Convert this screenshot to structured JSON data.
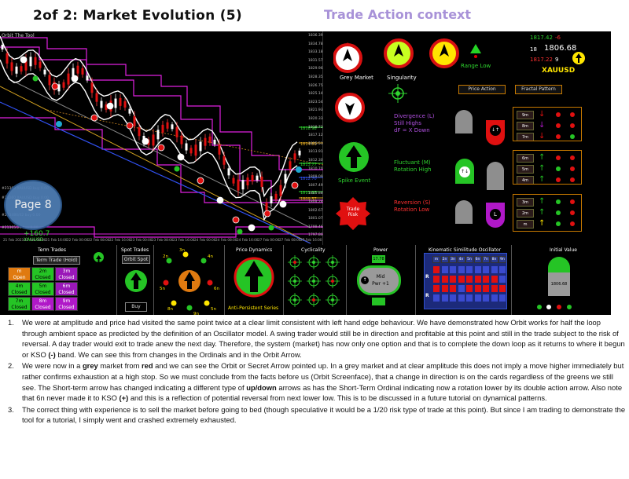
{
  "header": {
    "title": "2of 2: Market Evolution (5)",
    "context": "Trade Action context"
  },
  "chart": {
    "info": "Orbit The Tool",
    "price_labels": [
      "1818.98",
      "1814.81",
      "1813.77",
      "1812.70",
      "1811.37",
      "1809.57"
    ],
    "axis_prices": [
      "1836.39",
      "1834.78",
      "1833.18",
      "1831.57",
      "1829.96",
      "1828.35",
      "1826.75",
      "1825.14",
      "1823.54",
      "1821.93",
      "1820.33",
      "1818.72",
      "1817.12",
      "1815.51",
      "1813.91",
      "1812.30",
      "1810.70",
      "1809.09",
      "1807.49",
      "1805.88",
      "1804.28",
      "1802.67",
      "1801.07",
      "1799.46",
      "1797.86",
      "1796.25",
      "1794.64"
    ],
    "time_labels": [
      "21 Feb 2023",
      "21 Feb 08:00",
      "21 Feb 16:00",
      "22 Feb 00:00",
      "22 Feb 08:00",
      "22 Feb 16:00",
      "23 Feb 00:00",
      "23 Feb 08:00",
      "23 Feb 16:00",
      "24 Feb 00:00",
      "24 Feb 08:00",
      "24 Feb 16:00",
      "27 Feb 00:00",
      "27 Feb 08:00",
      "27 Feb 16:00"
    ],
    "sell_lines": [
      "#21360 XAUUSD buy 0.00",
      "#21260 XAUUSD buy 0.00",
      "#213486/42 buy 0.00",
      "#21365/24 buy 0.00"
    ],
    "profit": "+160.7",
    "sub": "XAUUSD"
  },
  "context": {
    "top_prices": {
      "p1": "1817.42",
      "p2": "1806.68",
      "p3": "1817.22"
    },
    "top_ids": {
      "a": "-6",
      "b": "18",
      "c": "9"
    },
    "symbol": "XAUUSD",
    "grey_market": "Grey Market",
    "singularity": "Singularity",
    "range_low": "Range Low",
    "spike_event": "Spike Event",
    "trade_risk": "Trade Risk",
    "price_action": "Price Action",
    "fractal_pattern": "Fractal Pattern",
    "divergence": [
      "Divergence (L)",
      "Still Highs",
      "dF = X Down"
    ],
    "fluctuant": [
      "Fluctuant (M)",
      "Rotation High"
    ],
    "reversion": [
      "Reversion (S)",
      "Rotation Low"
    ],
    "fractal_rows": [
      "9m",
      "8m",
      "7m",
      "6m",
      "5m",
      "4m",
      "3m",
      "2m",
      "m"
    ]
  },
  "bottom": {
    "term_trades": "Term Trades",
    "term_trade_hold": "Term Trade (Hold)",
    "term_cells": [
      [
        "m",
        "2m",
        "3m"
      ],
      [
        "Open",
        "Closed",
        "Closed"
      ],
      [
        "4m",
        "5m",
        "6m"
      ],
      [
        "Closed",
        "Closed",
        "Closed"
      ],
      [
        "7m",
        "8m",
        "9m"
      ],
      [
        "Closed",
        "Closed",
        "Closed"
      ]
    ],
    "spot_trades": "Spot Trades",
    "orbit_spot": "Orbit Spot",
    "buy": "Buy",
    "dial_labels": [
      "2n",
      "3n",
      "4n",
      "5n",
      "6n",
      "8n",
      "9n",
      "5n"
    ],
    "price_dynamics": "Price Dynamics",
    "anti_persistent": "Anti-Persistent Series",
    "cyclicality": "Cyclicality",
    "power": "Power",
    "power_value": "17.78",
    "mid_pwr": "Mid",
    "pwr_val": "Pwr +1",
    "kinematic": "Kinematic Similitude Oscillator",
    "kso_heads": [
      "m",
      "2n",
      "3n",
      "4n",
      "5n",
      "6n",
      "7n",
      "8n",
      "9n"
    ],
    "initial_value": "Initial Value",
    "iv": "1806.68"
  },
  "page_badge": "Page 8",
  "notes": [
    {
      "n": "1.",
      "parts": [
        {
          "t": "We were at amplitude and price had visited the same point twice at a clear limit consistent with left hand edge behaviour. We have demonstrated how Orbit works for half the loop through ambient space as predicted by the definition of an Oscillator model. A swing trader would still be in direction and profitable at this point and still in the trade subject to the risk of reversal. A day trader would exit to trade anew the next day. Therefore, the system (market) has now only one option and that is to complete the down loop as it returns to where it begun or KSO ",
          "b": false
        },
        {
          "t": "(-)",
          "b": true
        },
        {
          "t": " band. We can see this from changes in the Ordinals and in the Orbit Arrow.",
          "b": false
        }
      ]
    },
    {
      "n": "2.",
      "parts": [
        {
          "t": "We were now in a ",
          "b": false
        },
        {
          "t": "grey",
          "b": true
        },
        {
          "t": " market from ",
          "b": false
        },
        {
          "t": "red",
          "b": true
        },
        {
          "t": " and we can see the Orbit or Secret Arrow pointed up. In a grey market and at clear amplitude this does not imply a move higher immediately but rather confirms exhaustion at a high stop. So we must conclude from the facts before us (Orbit Screenface), that a change in direction is on the cards regardless of the greens we still see. The Short-term arrow has changed indicating a different type of ",
          "b": false
        },
        {
          "t": "up/down",
          "b": true
        },
        {
          "t": " arrows as has the Short-Term Ordinal indicating now a rotation lower by its double action arrow. Also note that 6n never made it to KSO ",
          "b": false
        },
        {
          "t": "(+)",
          "b": true
        },
        {
          "t": " and this is a reflection of potential reversal from next lower low. This is to be discussed in a future tutorial on dynamical patterns.",
          "b": false
        }
      ]
    },
    {
      "n": "3.",
      "parts": [
        {
          "t": "The correct thing with experience is to sell the market before going to bed (though speculative it would be a 1/20 risk type of trade at this point). But since I am trading to demonstrate the tool for a tutorial, I simply went and crashed extremely exhausted.",
          "b": false
        }
      ]
    }
  ]
}
